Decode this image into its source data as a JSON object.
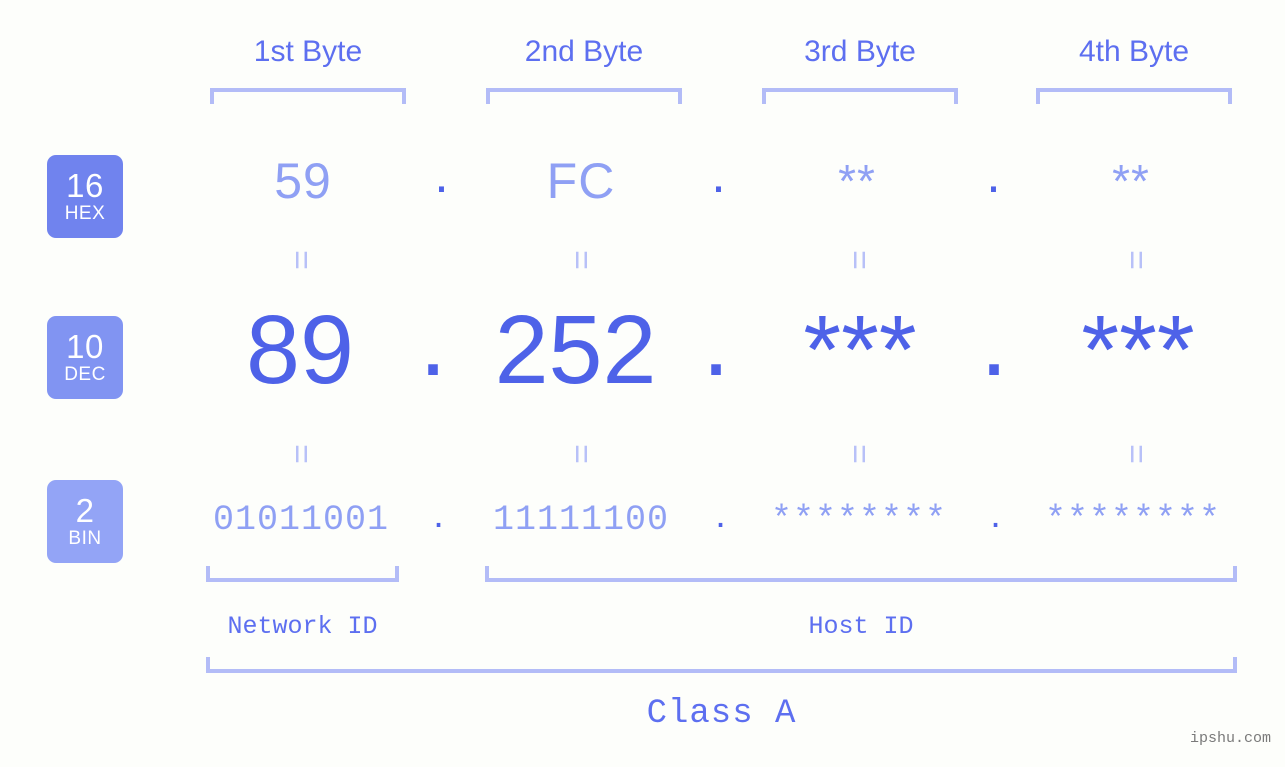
{
  "background_color": "#fdfefb",
  "accent_colors": {
    "strong_blue": "#4e62e8",
    "mid_blue": "#5d6ff0",
    "light_blue": "#8fa0f4",
    "pale_blue": "#b3bcf7",
    "badge_hex": "#7083ee",
    "badge_dec": "#8194f2",
    "badge_bin": "#93a4f6",
    "watermark_gray": "#7a7a7a"
  },
  "byte_headers": [
    {
      "label": "1st Byte"
    },
    {
      "label": "2nd Byte"
    },
    {
      "label": "3rd Byte"
    },
    {
      "label": "4th Byte"
    }
  ],
  "bases": [
    {
      "number": "16",
      "system": "HEX"
    },
    {
      "number": "10",
      "system": "DEC"
    },
    {
      "number": "2",
      "system": "BIN"
    }
  ],
  "rows": {
    "hex": {
      "base_number": "16",
      "base_system": "HEX",
      "values": [
        "59",
        "FC",
        "**",
        "**"
      ],
      "separator": "."
    },
    "dec": {
      "base_number": "10",
      "base_system": "DEC",
      "values": [
        "89",
        "252",
        "***",
        "***"
      ],
      "separator": "."
    },
    "bin": {
      "base_number": "2",
      "base_system": "BIN",
      "values": [
        "01011001",
        "11111100",
        "********",
        "********"
      ],
      "separator": "."
    }
  },
  "equality_marks": {
    "glyph": "=",
    "count_per_row": 4
  },
  "id_sections": [
    {
      "label": "Network ID"
    },
    {
      "label": "Host ID"
    }
  ],
  "class": {
    "label": "Class A"
  },
  "watermark": {
    "text": "ipshu.com"
  }
}
